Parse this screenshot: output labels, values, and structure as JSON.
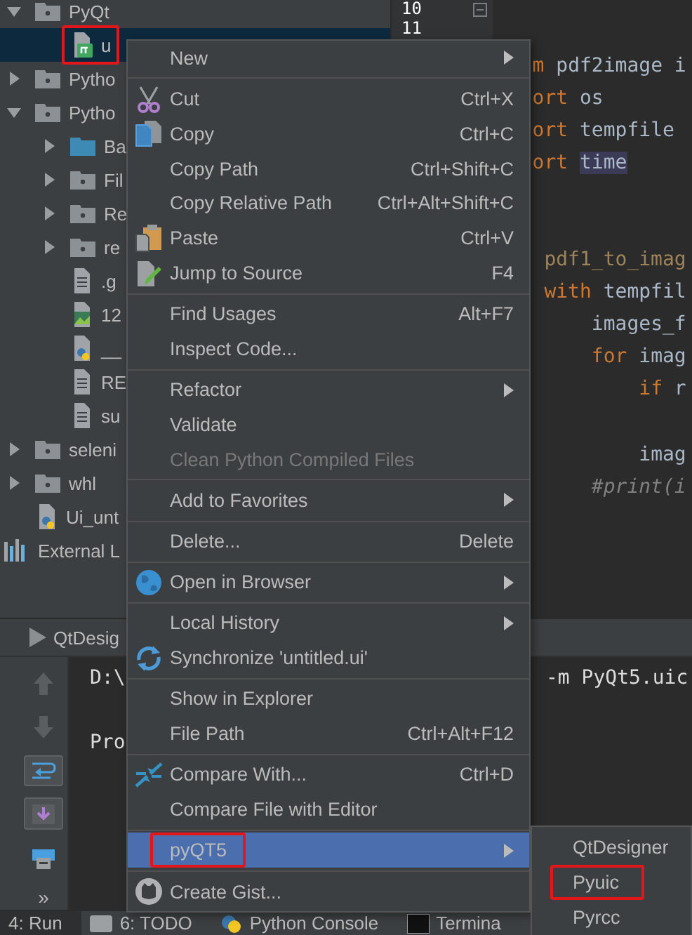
{
  "project_tree": [
    {
      "label": "PyQt",
      "kind": "package",
      "expanded": true,
      "selected": false,
      "children": [
        {
          "label": "u",
          "kind": "qt",
          "selected": true,
          "highlighted": true
        }
      ]
    },
    {
      "label": "Pytho",
      "kind": "package",
      "expanded": false,
      "selected": false
    },
    {
      "label": "Pytho",
      "kind": "package",
      "expanded": true,
      "selected": false,
      "children": [
        {
          "label": "Ba",
          "kind": "folder",
          "expanded": false,
          "selected": false
        },
        {
          "label": "Fil",
          "kind": "package",
          "expanded": false,
          "selected": false
        },
        {
          "label": "Re",
          "kind": "package",
          "expanded": false,
          "selected": false
        },
        {
          "label": "re",
          "kind": "package",
          "expanded": false,
          "selected": false
        },
        {
          "label": ".g",
          "kind": "text",
          "selected": false
        },
        {
          "label": "12",
          "kind": "image",
          "selected": false
        },
        {
          "label": "__",
          "kind": "python",
          "selected": false
        },
        {
          "label": "RE",
          "kind": "text",
          "selected": false
        },
        {
          "label": "su",
          "kind": "text",
          "selected": false
        }
      ]
    },
    {
      "label": "seleni",
      "kind": "package",
      "expanded": false,
      "selected": false
    },
    {
      "label": "whl",
      "kind": "package",
      "expanded": false,
      "selected": false
    },
    {
      "label": "Ui_unt",
      "kind": "python",
      "selected": false
    },
    {
      "label": "External L",
      "kind": "library",
      "selected": false
    }
  ],
  "editor": {
    "line_numbers": [
      "10",
      "11"
    ],
    "lines": [
      {
        "kind": "cut",
        "tokens": [
          {
            "text": "m",
            "kind": "keyword"
          },
          {
            "text": "pdf2image i",
            "kind": "plain"
          }
        ]
      },
      {
        "kind": "cut",
        "tokens": [
          {
            "text": "ort",
            "kind": "keyword"
          },
          {
            "text": "os",
            "kind": "plain"
          }
        ]
      },
      {
        "kind": "cut",
        "tokens": [
          {
            "text": "ort",
            "kind": "keyword"
          },
          {
            "text": "tempfile",
            "kind": "plain"
          }
        ]
      },
      {
        "kind": "cut",
        "tokens": [
          {
            "text": "ort",
            "kind": "keyword"
          },
          {
            "text": "time",
            "kind": "highlight"
          }
        ]
      },
      {
        "kind": "blank"
      },
      {
        "kind": "blank"
      },
      {
        "kind": "definition",
        "tokens": [
          {
            "text": "pdf1_to_imag",
            "kind": "function"
          }
        ],
        "children": [
          {
            "kind": "code",
            "tokens": [
              {
                "text": "with",
                "kind": "keyword"
              },
              {
                "text": "tempfil",
                "kind": "plain"
              }
            ],
            "children": [
              {
                "kind": "code",
                "tokens": [
                  {
                    "text": "images_f",
                    "kind": "plain"
                  }
                ]
              },
              {
                "kind": "code",
                "tokens": [
                  {
                    "text": "for",
                    "kind": "keyword"
                  },
                  {
                    "text": "imag",
                    "kind": "plain"
                  }
                ],
                "children": [
                  {
                    "kind": "code",
                    "tokens": [
                      {
                        "text": "if",
                        "kind": "keyword"
                      },
                      {
                        "text": "r",
                        "kind": "plain"
                      }
                    ]
                  },
                  {
                    "kind": "blank"
                  },
                  {
                    "kind": "code",
                    "tokens": [
                      {
                        "text": "imag",
                        "kind": "plain"
                      }
                    ]
                  }
                ]
              },
              {
                "kind": "code",
                "tokens": [
                  {
                    "text": "#print(i",
                    "kind": "comment"
                  }
                ]
              }
            ]
          }
        ]
      }
    ]
  },
  "run_panel": {
    "tab": "QtDesig",
    "more": "»",
    "console": [
      {
        "kind": "text",
        "segments": [
          "D:\\",
          "-m PyQt5.uic"
        ]
      },
      {
        "kind": "blank"
      },
      {
        "kind": "text",
        "segments": [
          "Pro"
        ]
      }
    ]
  },
  "bottom_tabs": [
    {
      "label": "4: Run",
      "selected": true
    },
    {
      "label": "6: TODO",
      "selected": false
    },
    {
      "label": "Python Console",
      "selected": false
    },
    {
      "label": "Termina",
      "selected": false
    }
  ],
  "context_menu": {
    "groups": [
      [
        {
          "label": "New",
          "submenu": true,
          "selected": false
        }
      ],
      [
        {
          "label": "Cut",
          "shortcut": "Ctrl+X",
          "selected": false
        },
        {
          "label": "Copy",
          "shortcut": "Ctrl+C",
          "selected": false
        },
        {
          "label": "Copy Path",
          "shortcut": "Ctrl+Shift+C",
          "selected": false
        },
        {
          "label": "Copy Relative Path",
          "shortcut": "Ctrl+Alt+Shift+C",
          "selected": false
        },
        {
          "label": "Paste",
          "shortcut": "Ctrl+V",
          "selected": false
        },
        {
          "label": "Jump to Source",
          "shortcut": "F4",
          "selected": false
        }
      ],
      [
        {
          "label": "Find Usages",
          "shortcut": "Alt+F7",
          "selected": false
        },
        {
          "label": "Inspect Code...",
          "selected": false
        }
      ],
      [
        {
          "label": "Refactor",
          "submenu": true,
          "selected": false
        },
        {
          "label": "Validate",
          "selected": false
        },
        {
          "label": "Clean Python Compiled Files",
          "disabled": true,
          "selected": false
        }
      ],
      [
        {
          "label": "Add to Favorites",
          "submenu": true,
          "selected": false
        }
      ],
      [
        {
          "label": "Delete...",
          "shortcut": "Delete",
          "selected": false
        }
      ],
      [
        {
          "label": "Open in Browser",
          "submenu": true,
          "selected": false
        }
      ],
      [
        {
          "label": "Local History",
          "submenu": true,
          "selected": false
        },
        {
          "label": "Synchronize 'untitled.ui'",
          "selected": false
        }
      ],
      [
        {
          "label": "Show in Explorer",
          "selected": false
        },
        {
          "label": "File Path",
          "shortcut": "Ctrl+Alt+F12",
          "selected": false
        }
      ],
      [
        {
          "label": "Compare With...",
          "shortcut": "Ctrl+D",
          "selected": false
        },
        {
          "label": "Compare File with Editor",
          "selected": false
        }
      ],
      [
        {
          "label": "pyQT5",
          "submenu": true,
          "selected": true,
          "highlighted": true
        }
      ],
      [
        {
          "label": "Create Gist...",
          "selected": false
        }
      ]
    ]
  },
  "submenu": {
    "items": [
      {
        "label": "QtDesigner",
        "selected": false
      },
      {
        "label": "Pyuic",
        "selected": false,
        "highlighted": true
      },
      {
        "label": "Pyrcc",
        "selected": false
      }
    ]
  }
}
